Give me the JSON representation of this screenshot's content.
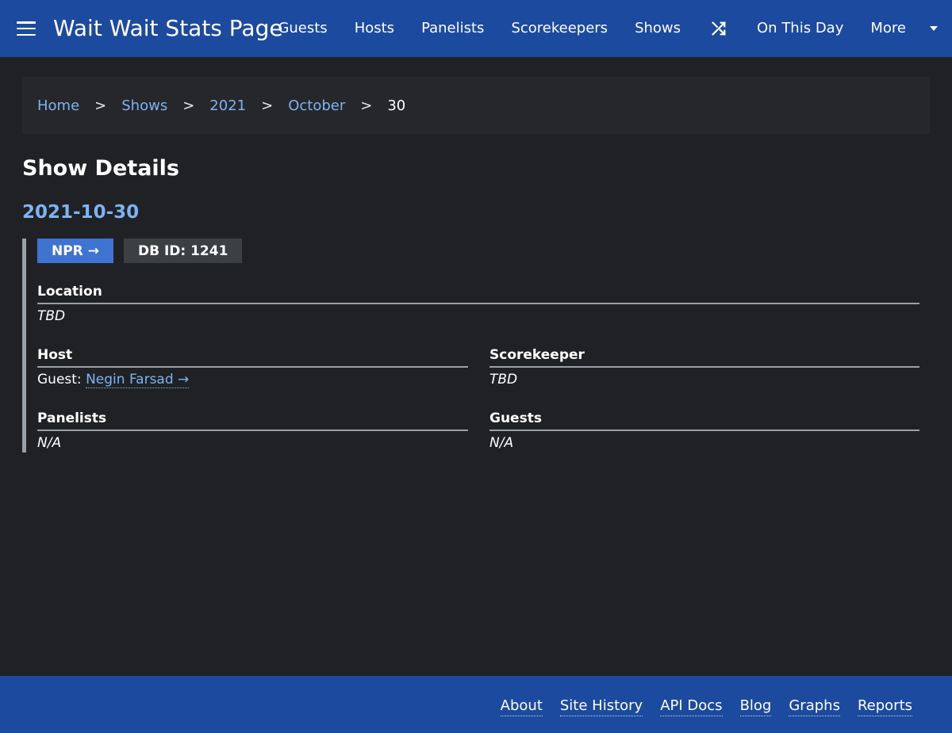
{
  "header": {
    "site_title": "Wait Wait Stats Page",
    "nav_items": [
      "Guests",
      "Hosts",
      "Panelists",
      "Scorekeepers",
      "Shows"
    ],
    "random_icon": "shuffle-icon",
    "on_this_day": "On This Day",
    "more": "More"
  },
  "breadcrumb": {
    "home": "Home",
    "shows": "Shows",
    "year": "2021",
    "month": "October",
    "day": "30",
    "separator": ">"
  },
  "main": {
    "title": "Show Details",
    "show_date": "2021-10-30",
    "npr_badge": "NPR →",
    "db_id_badge": "DB ID: 1241",
    "location": {
      "label": "Location",
      "value": "TBD"
    },
    "host": {
      "label": "Host",
      "prefix": "Guest:",
      "name": "Negin Farsad →"
    },
    "scorekeeper": {
      "label": "Scorekeeper",
      "value": "TBD"
    },
    "panelists": {
      "label": "Panelists",
      "value": "N/A"
    },
    "guests": {
      "label": "Guests",
      "value": "N/A"
    }
  },
  "footer": {
    "links": [
      "About",
      "Site History",
      "API Docs",
      "Blog",
      "Graphs",
      "Reports"
    ]
  },
  "colors": {
    "header_bg": "#1b4a9e",
    "page_bg": "#202124",
    "link": "#7db3f0",
    "npr_badge_bg": "#3f73d1"
  }
}
